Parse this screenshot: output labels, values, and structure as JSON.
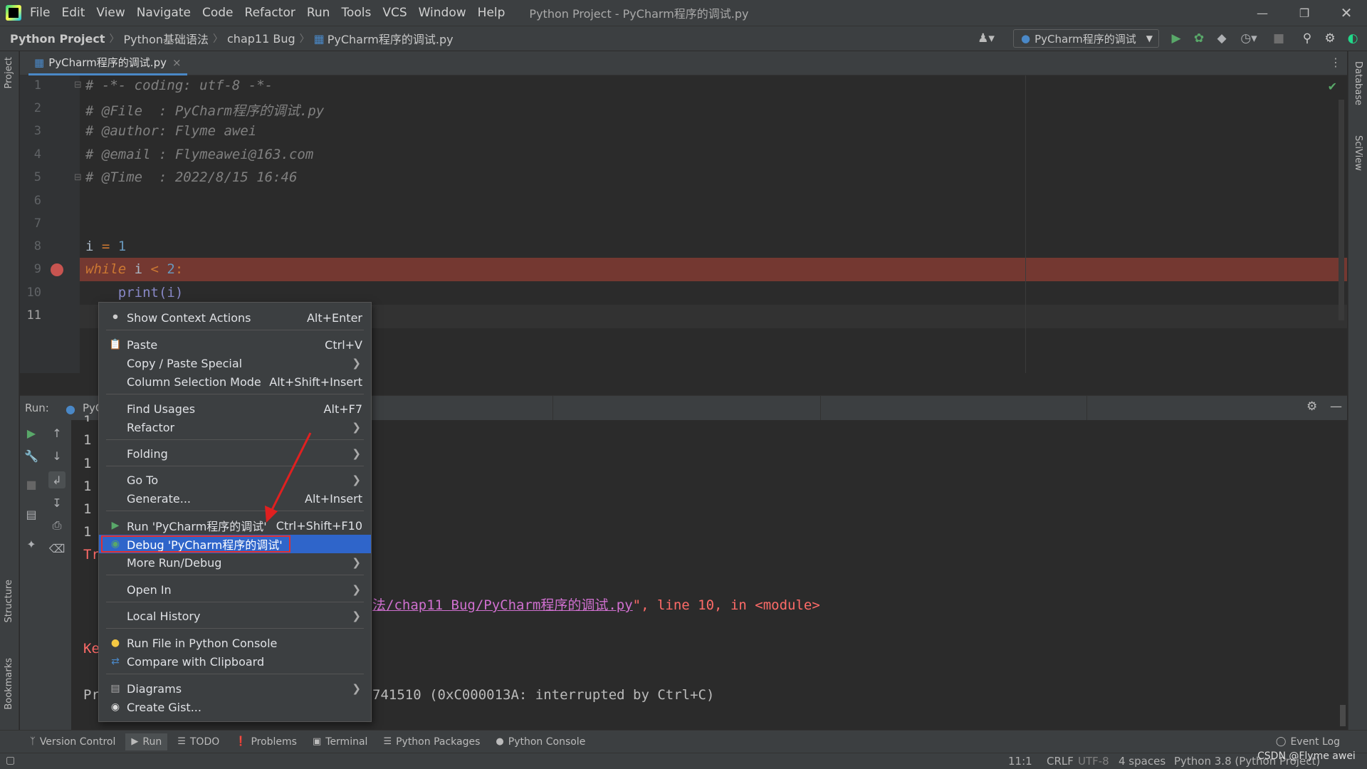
{
  "app": {
    "menus": [
      "File",
      "Edit",
      "View",
      "Navigate",
      "Code",
      "Refactor",
      "Run",
      "Tools",
      "VCS",
      "Window",
      "Help"
    ],
    "window_title": "Python Project - PyCharm程序的调试.py"
  },
  "breadcrumb": [
    "Python Project",
    "Python基础语法",
    "chap11 Bug",
    "PyCharm程序的调试.py"
  ],
  "run_config": "PyCharm程序的调试",
  "editor_tab": {
    "label": "PyCharm程序的调试.py",
    "close": "×"
  },
  "side_tools": {
    "project": "Project",
    "structure": "Structure",
    "bookmarks": "Bookmarks",
    "database": "Database",
    "sciview": "SciView"
  },
  "code": {
    "line_numbers": [
      "1",
      "2",
      "3",
      "4",
      "5",
      "6",
      "7",
      "8",
      "9",
      "10",
      "11"
    ],
    "l1": "# -*- coding: utf-8 -*-",
    "l2": "# @File  : PyCharm程序的调试.py",
    "l3": "# @author: Flyme awei",
    "l4": "# @email : Flymeawei@163.com",
    "l5": "# @Time  : 2022/8/15 16:46",
    "l8_a": "i ",
    "l8_op": "=",
    "l8_b": " 1",
    "l9_kw": "while",
    "l9_a": " i ",
    "l9_op": "<",
    "l9_b": " 2",
    "l9_c": ":",
    "l10": "    print(i)"
  },
  "run_panel": {
    "label": "Run:",
    "tab": "PyC",
    "outputs": [
      "1",
      "1",
      "1",
      "1",
      "1",
      "1"
    ],
    "tr": "Tr",
    "ke": "Ke",
    "pr": "Pr",
    "trace_link": "法/chap11 Bug/PyCharm程序的调试.py",
    "trace_rest": "\", line 10, in <module>",
    "exit": "741510 (0xC000013A: interrupted by Ctrl+C)"
  },
  "context_menu": [
    {
      "label": "Show Context Actions",
      "shortcut": "Alt+Enter"
    },
    {
      "label": "Paste",
      "shortcut": "Ctrl+V"
    },
    {
      "label": "Copy / Paste Special",
      "shortcut": ""
    },
    {
      "label": "Column Selection Mode",
      "shortcut": "Alt+Shift+Insert"
    },
    {
      "label": "Find Usages",
      "shortcut": "Alt+F7"
    },
    {
      "label": "Refactor",
      "shortcut": ""
    },
    {
      "label": "Folding",
      "shortcut": ""
    },
    {
      "label": "Go To",
      "shortcut": ""
    },
    {
      "label": "Generate...",
      "shortcut": "Alt+Insert"
    },
    {
      "label": "Run 'PyCharm程序的调试'",
      "shortcut": "Ctrl+Shift+F10"
    },
    {
      "label": "Debug 'PyCharm程序的调试'",
      "shortcut": ""
    },
    {
      "label": "More Run/Debug",
      "shortcut": ""
    },
    {
      "label": "Open In",
      "shortcut": ""
    },
    {
      "label": "Local History",
      "shortcut": ""
    },
    {
      "label": "Run File in Python Console",
      "shortcut": ""
    },
    {
      "label": "Compare with Clipboard",
      "shortcut": ""
    },
    {
      "label": "Diagrams",
      "shortcut": ""
    },
    {
      "label": "Create Gist...",
      "shortcut": ""
    }
  ],
  "bottom_tabs": [
    "Version Control",
    "Run",
    "TODO",
    "Problems",
    "Terminal",
    "Python Packages",
    "Python Console"
  ],
  "event_log": "Event Log",
  "status": {
    "pos": "11:1",
    "eol": "CRLF",
    "enc": "UTF-8",
    "indent": "4 spaces",
    "interp": "Python 3.8 (Python Project)",
    "watermark": "CSDN @Flyme awei"
  },
  "colors": {
    "accent": "#2f65ca",
    "breakpoint": "#c75450",
    "bp_line": "#743831",
    "string_link": "#d070d0",
    "error": "#ff6b68"
  }
}
